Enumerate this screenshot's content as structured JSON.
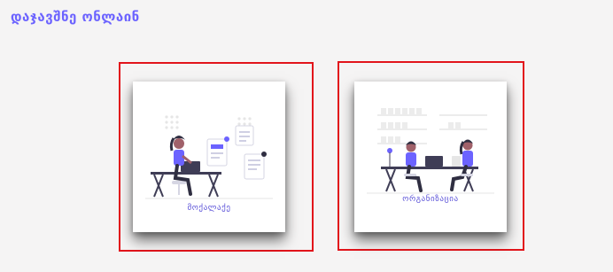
{
  "page": {
    "title": "დაჯავშნე ონლაინ"
  },
  "cards": {
    "visitor": {
      "label": "მოქალაქე",
      "icon": "person-at-laptop-with-documents-illustration"
    },
    "organization": {
      "label": "ორგანიზაცია",
      "icon": "two-people-at-desk-office-illustration"
    }
  },
  "colors": {
    "accent": "#6c63ff",
    "frame": "#e2141b",
    "background": "#f5f4f4",
    "skin": "#a0616a",
    "hair": "#2f2e41"
  }
}
